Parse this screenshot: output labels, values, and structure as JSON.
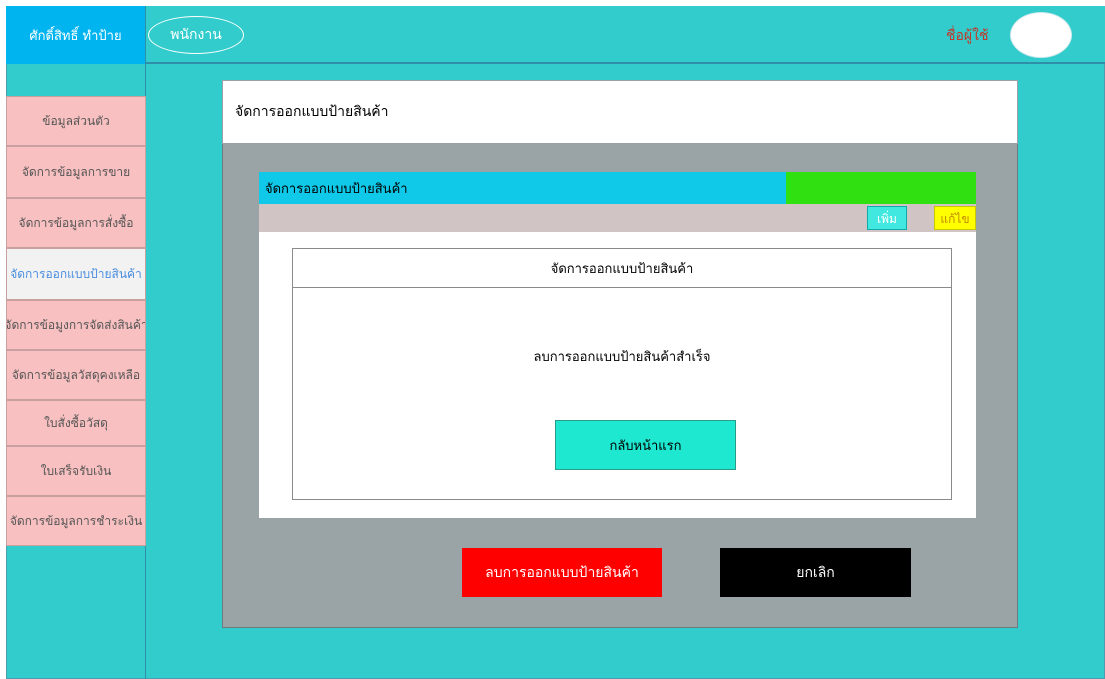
{
  "header": {
    "brand": "ศักดิ์สิทธิ์ ทำป้าย",
    "role": "พนักงาน",
    "username": "ชื่อผู้ใช้"
  },
  "sidebar": {
    "items": [
      {
        "label": "ข้อมูลส่วนตัว",
        "active": false
      },
      {
        "label": "จัดการข้อมูลการขาย",
        "active": false
      },
      {
        "label": "จัดการข้อมูลการสั่งซื้อ",
        "active": false
      },
      {
        "label": "จัดการออกแบบป้ายสินค้า",
        "active": true
      },
      {
        "label": "จัดการข้อมูงการจัดส่งสินค้า",
        "active": false
      },
      {
        "label": "จัดการข้อมูลวัสดุคงเหลือ",
        "active": false
      },
      {
        "label": "ใบสั่งซื้อวัสดุ",
        "active": false
      },
      {
        "label": "ใบเสร็จรับเงิน",
        "active": false
      },
      {
        "label": "จัดการข้อมูลการชำระเงิน",
        "active": false
      }
    ]
  },
  "main": {
    "page_title": "จัดการออกแบบป้ายสินค้า",
    "inner_title": "จัดการออกแบบป้ายสินค้า",
    "add_label": "เพิ่ม",
    "edit_label": "แก้ไข",
    "dialog_title": "จัดการออกแบบป้ายสินค้า",
    "dialog_message": "ลบการออกแบบป้ายสินค้าสำเร็จ",
    "home_button": "กลับหน้าแรก",
    "delete_button": "ลบการออกแบบป้ายสินค้า",
    "cancel_button": "ยกเลิก"
  },
  "colors": {
    "background": "#33cccc",
    "brand": "#00b4f0",
    "sidebar_item": "#f8c0c0",
    "delete": "#ff0000",
    "cancel": "#000000",
    "home_button": "#1ee8d0"
  }
}
